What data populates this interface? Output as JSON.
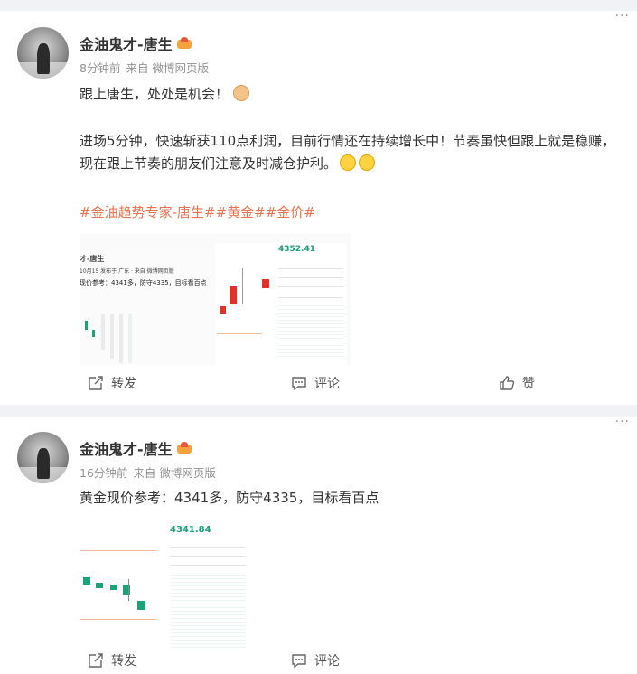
{
  "posts": [
    {
      "author": "金油鬼才-唐生",
      "time": "8分钟前",
      "source_prefix": "来自",
      "source": "微博网页版",
      "line1": "跟上唐生，处处是机会！",
      "line2": "进场5分钟，快速斩获110点利润，目前行情还在持续增长中！节奏虽快但跟上就是稳赚，现在跟上节奏的朋友们注意及时减仓护利。",
      "topics": "#金油趋势专家-唐生##黄金##金价#",
      "img_left": {
        "name": "才-唐生",
        "sub": "10月15 发布于 广东 · 来自 微博网页版",
        "text": "现价参考：4341多，防守4335，目标看百点"
      },
      "img_right": {
        "price": "4352.41"
      },
      "actions": {
        "repost": "转发",
        "comment": "评论",
        "like": "赞"
      }
    },
    {
      "author": "金油鬼才-唐生",
      "time": "16分钟前",
      "source_prefix": "来自",
      "source": "微博网页版",
      "line1": "黄金现价参考：4341多，防守4335，目标看百点",
      "img": {
        "price": "4341.84"
      },
      "actions": {
        "repost": "转发",
        "comment": "评论"
      }
    }
  ],
  "more_glyph": "···",
  "colors": {
    "topic": "#eb7350",
    "up": "#e0312a",
    "down": "#1aa37a"
  }
}
